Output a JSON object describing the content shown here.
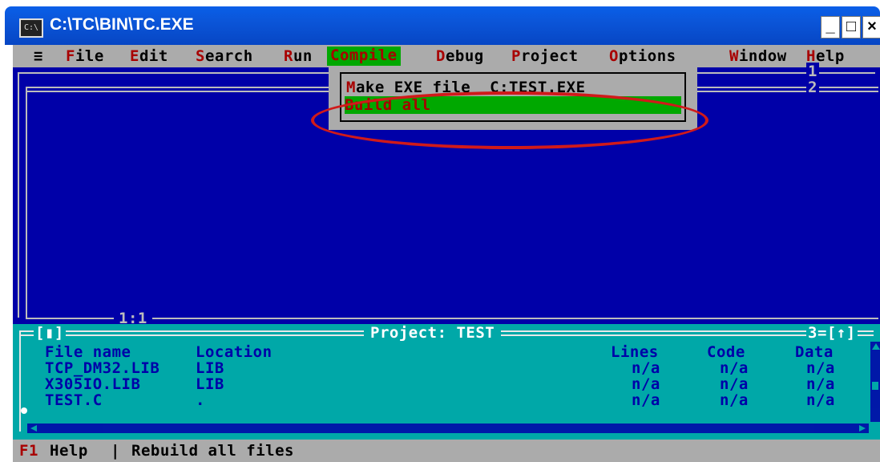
{
  "window": {
    "title": "C:\\TC\\BIN\\TC.EXE",
    "icon_text": "C:\\",
    "minimize": "_",
    "maximize": "□",
    "close": "×"
  },
  "menu": {
    "system": "≡",
    "items": [
      {
        "hot": "F",
        "rest": "ile"
      },
      {
        "hot": "E",
        "rest": "dit"
      },
      {
        "hot": "S",
        "rest": "earch"
      },
      {
        "hot": "R",
        "rest": "un"
      },
      {
        "hot": "C",
        "rest": "ompile"
      },
      {
        "hot": "D",
        "rest": "ebug"
      },
      {
        "hot": "P",
        "rest": "roject"
      },
      {
        "hot": "O",
        "rest": "ptions"
      },
      {
        "hot": "W",
        "rest": "indow"
      },
      {
        "hot": "H",
        "rest": "elp"
      }
    ]
  },
  "editor": {
    "window_numbers": [
      "1",
      "2"
    ],
    "cursor_pos": "1:1"
  },
  "compile_menu": {
    "make_hot": "M",
    "make_rest": "ake EXE file",
    "make_target": "C:TEST.EXE",
    "build_hot": "B",
    "build_rest": "uild all"
  },
  "project": {
    "title": "Project: TEST",
    "left_tag": "[▮]",
    "right_tag": "3=[↑]",
    "columns": {
      "file": "File name",
      "location": "Location",
      "lines": "Lines",
      "code": "Code",
      "data": "Data"
    },
    "rows": [
      {
        "file": "TCP_DM32.LIB",
        "location": "LIB",
        "lines": "n/a",
        "code": "n/a",
        "data": "n/a"
      },
      {
        "file": "X305IO.LIB",
        "location": "LIB",
        "lines": "n/a",
        "code": "n/a",
        "data": "n/a"
      },
      {
        "file": "TEST.C",
        "location": ".",
        "lines": "n/a",
        "code": "n/a",
        "data": "n/a"
      }
    ]
  },
  "status": {
    "key": "F1",
    "key_label": "Help",
    "separator": "|",
    "message": "Rebuild all files"
  },
  "colors": {
    "dos_blue": "#0000a8",
    "menu_gray": "#ababab",
    "highlight_green": "#00a800",
    "hotkey_red": "#a80000",
    "panel_cyan": "#00a8a8",
    "annotation_red": "#d01a1a"
  }
}
